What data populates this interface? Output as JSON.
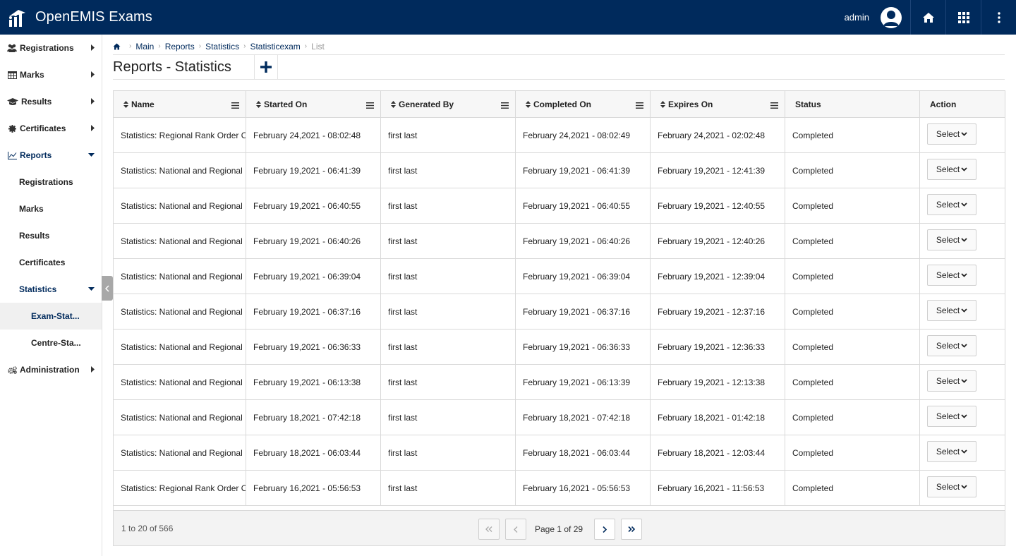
{
  "header": {
    "app_title": "OpenEMIS Exams",
    "user": "admin"
  },
  "sidebar": {
    "items": [
      {
        "label": "Registrations",
        "icon": "users-icon"
      },
      {
        "label": "Marks",
        "icon": "table-icon"
      },
      {
        "label": "Results",
        "icon": "graduation-cap-icon"
      },
      {
        "label": "Certificates",
        "icon": "certificate-icon"
      },
      {
        "label": "Reports",
        "icon": "line-chart-icon"
      },
      {
        "label": "Registrations"
      },
      {
        "label": "Marks"
      },
      {
        "label": "Results"
      },
      {
        "label": "Certificates"
      },
      {
        "label": "Statistics"
      },
      {
        "label": "Exam-Stat..."
      },
      {
        "label": "Centre-Sta..."
      },
      {
        "label": "Administration",
        "icon": "cogs-icon"
      }
    ]
  },
  "breadcrumb": {
    "items": [
      "Main",
      "Reports",
      "Statistics",
      "Statisticexam"
    ],
    "current": "List"
  },
  "page": {
    "title": "Reports - Statistics"
  },
  "table": {
    "columns": [
      "Name",
      "Started On",
      "Generated By",
      "Completed On",
      "Expires On",
      "Status",
      "Action"
    ],
    "select_label": "Select",
    "rows": [
      [
        "Statistics: Regional Rank Order Of",
        "February 24,2021 - 08:02:48",
        "first last",
        "February 24,2021 - 08:02:49",
        "February 24,2021 - 02:02:48",
        "Completed"
      ],
      [
        "Statistics: National and Regional",
        "February 19,2021 - 06:41:39",
        "first last",
        "February 19,2021 - 06:41:39",
        "February 19,2021 - 12:41:39",
        "Completed"
      ],
      [
        "Statistics: National and Regional",
        "February 19,2021 - 06:40:55",
        "first last",
        "February 19,2021 - 06:40:55",
        "February 19,2021 - 12:40:55",
        "Completed"
      ],
      [
        "Statistics: National and Regional",
        "February 19,2021 - 06:40:26",
        "first last",
        "February 19,2021 - 06:40:26",
        "February 19,2021 - 12:40:26",
        "Completed"
      ],
      [
        "Statistics: National and Regional",
        "February 19,2021 - 06:39:04",
        "first last",
        "February 19,2021 - 06:39:04",
        "February 19,2021 - 12:39:04",
        "Completed"
      ],
      [
        "Statistics: National and Regional",
        "February 19,2021 - 06:37:16",
        "first last",
        "February 19,2021 - 06:37:16",
        "February 19,2021 - 12:37:16",
        "Completed"
      ],
      [
        "Statistics: National and Regional",
        "February 19,2021 - 06:36:33",
        "first last",
        "February 19,2021 - 06:36:33",
        "February 19,2021 - 12:36:33",
        "Completed"
      ],
      [
        "Statistics: National and Regional",
        "February 19,2021 - 06:13:38",
        "first last",
        "February 19,2021 - 06:13:39",
        "February 19,2021 - 12:13:38",
        "Completed"
      ],
      [
        "Statistics: National and Regional",
        "February 18,2021 - 07:42:18",
        "first last",
        "February 18,2021 - 07:42:18",
        "February 18,2021 - 01:42:18",
        "Completed"
      ],
      [
        "Statistics: National and Regional",
        "February 18,2021 - 06:03:44",
        "first last",
        "February 18,2021 - 06:03:44",
        "February 18,2021 - 12:03:44",
        "Completed"
      ],
      [
        "Statistics: Regional Rank Order Of",
        "February 16,2021 - 05:56:53",
        "first last",
        "February 16,2021 - 05:56:53",
        "February 16,2021 - 11:56:53",
        "Completed"
      ]
    ]
  },
  "footer": {
    "row_count": "1 to 20 of 566",
    "page_label": "Page 1 of 29"
  },
  "colors": {
    "brand": "#002a5c",
    "border": "#d9d9d9"
  }
}
